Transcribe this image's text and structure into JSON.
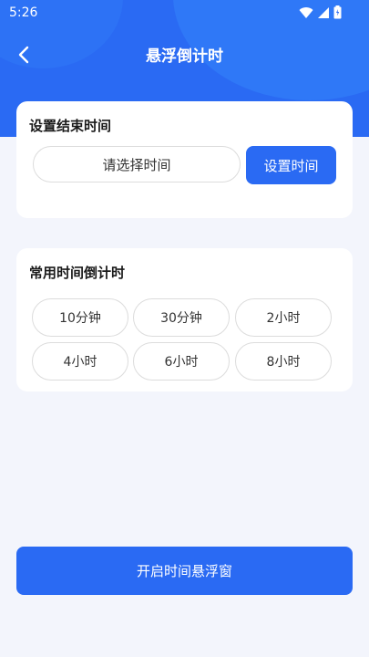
{
  "status_bar": {
    "time": "5:26",
    "icons": [
      "wifi-icon",
      "cellular-signal-icon",
      "battery-icon"
    ]
  },
  "header": {
    "title": "悬浮倒计时",
    "back_icon": "chevron-left-icon"
  },
  "end_time_card": {
    "title": "设置结束时间",
    "select_placeholder": "请选择时间",
    "set_button_label": "设置时间"
  },
  "common_card": {
    "title": "常用时间倒计时",
    "presets": [
      "10分钟",
      "30分钟",
      "2小时",
      "4小时",
      "6小时",
      "8小时"
    ]
  },
  "footer": {
    "open_button_label": "开启时间悬浮窗"
  },
  "colors": {
    "accent": "#2a6af3",
    "background": "#f3f5fc",
    "card": "#ffffff",
    "border": "#dcdcdc"
  }
}
